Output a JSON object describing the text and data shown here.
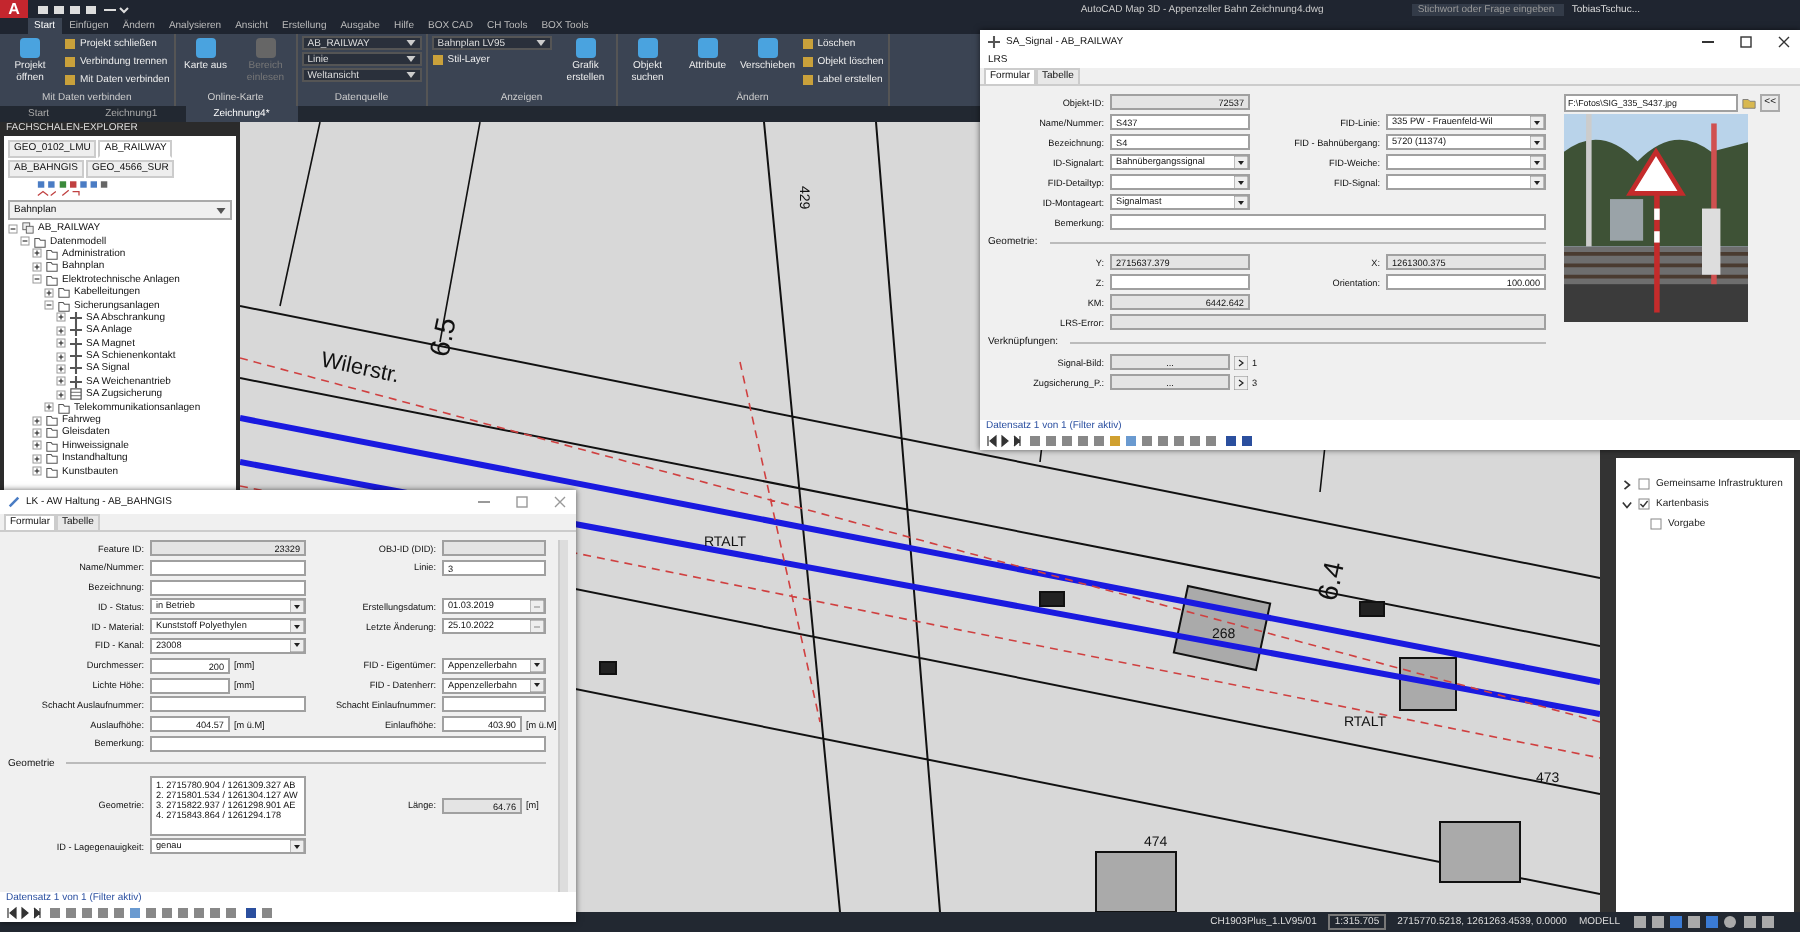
{
  "title_bar": {
    "app_logo": "A",
    "title": "AutoCAD Map 3D - Appenzeller Bahn  Zeichnung4.dwg",
    "search": {
      "placeholder": "Stichwort oder Frage eingeben"
    },
    "user": "TobiasTschuc..."
  },
  "ribbon": {
    "tabs": [
      {
        "label": "Start",
        "selected": true
      },
      {
        "label": "Einfügen",
        "selected": false
      },
      {
        "label": "Ändern",
        "selected": false
      },
      {
        "label": "Analysieren",
        "selected": false
      },
      {
        "label": "Ansicht",
        "selected": false
      },
      {
        "label": "Erstellung",
        "selected": false
      },
      {
        "label": "Ausgabe",
        "selected": false
      },
      {
        "label": "Hilfe",
        "selected": false
      },
      {
        "label": "BOX CAD",
        "selected": false
      },
      {
        "label": "CH Tools",
        "selected": false
      },
      {
        "label": "BOX Tools",
        "selected": false
      }
    ],
    "groups": [
      {
        "title": "Mit Daten verbinden",
        "items": [
          {
            "label": "Projekt öffnen",
            "kind": "large"
          },
          {
            "label": "Projekt schließen",
            "kind": "small"
          },
          {
            "label": "Verbindung trennen",
            "kind": "small"
          },
          {
            "label": "Mit Daten verbinden",
            "kind": "small"
          }
        ]
      },
      {
        "title": "Online-Karte",
        "items": [
          {
            "label": "Karte aus",
            "kind": "large"
          },
          {
            "label": "Bereich einlesen",
            "kind": "large",
            "disabled": true
          }
        ]
      },
      {
        "title": "Datenquelle",
        "items": [
          {
            "label": "AB_RAILWAY",
            "kind": "dropdown"
          },
          {
            "label": "Linie",
            "kind": "dropdown"
          },
          {
            "label": "Weltansicht",
            "kind": "dropdown"
          }
        ]
      },
      {
        "title": "Anzeigen",
        "items": [
          {
            "label": "Bahnplan LV95",
            "kind": "dropdown"
          },
          {
            "label": "Stil-Layer",
            "kind": "small"
          },
          {
            "label": "Grafik erstellen",
            "kind": "large"
          }
        ]
      },
      {
        "title": "Ändern",
        "items": [
          {
            "label": "Objekt suchen",
            "kind": "large"
          },
          {
            "label": "Attribute",
            "kind": "large"
          },
          {
            "label": "Verschieben",
            "kind": "large"
          },
          {
            "label": "Löschen",
            "kind": "small"
          },
          {
            "label": "Objekt löschen",
            "kind": "small"
          },
          {
            "label": "Label erstellen",
            "kind": "small"
          }
        ]
      }
    ]
  },
  "document_tabs": [
    {
      "label": "Start",
      "selected": false
    },
    {
      "label": "Zeichnung1",
      "selected": false
    },
    {
      "label": "Zeichnung4*",
      "selected": true
    }
  ],
  "explorer": {
    "title": "FACHSCHALEN-EXPLORER",
    "tabs": [
      {
        "label": "GEO_0102_LMU",
        "selected": false
      },
      {
        "label": "AB_RAILWAY",
        "selected": true
      },
      {
        "label": "AB_BAHNGIS",
        "selected": false
      },
      {
        "label": "GEO_4566_SUR",
        "selected": false
      }
    ],
    "view": "Bahnplan",
    "tree": [
      {
        "label": "AB_RAILWAY",
        "kind": "root",
        "expanded": true,
        "children": [
          {
            "label": "Datenmodell",
            "kind": "model",
            "expanded": true,
            "children": [
              {
                "label": "Administration",
                "kind": "folder",
                "expanded": false
              },
              {
                "label": "Bahnplan",
                "kind": "folder",
                "expanded": false
              },
              {
                "label": "Elektrotechnische Anlagen",
                "kind": "folder",
                "expanded": true,
                "children": [
                  {
                    "label": "Kabelleitungen",
                    "kind": "folder",
                    "expanded": false
                  },
                  {
                    "label": "Sicherungsanlagen",
                    "kind": "folder",
                    "expanded": true,
                    "children": [
                      {
                        "label": "SA Abschrankung",
                        "kind": "class",
                        "expanded": false
                      },
                      {
                        "label": "SA Anlage",
                        "kind": "class",
                        "expanded": false
                      },
                      {
                        "label": "SA Magnet",
                        "kind": "class",
                        "expanded": false
                      },
                      {
                        "label": "SA Schienenkontakt",
                        "kind": "class",
                        "expanded": false
                      },
                      {
                        "label": "SA Signal",
                        "kind": "class",
                        "expanded": false
                      },
                      {
                        "label": "SA Weichenantrieb",
                        "kind": "class",
                        "expanded": false
                      },
                      {
                        "label": "SA Zugsicherung",
                        "kind": "table",
                        "expanded": false
                      }
                    ]
                  },
                  {
                    "label": "Telekommunikationsanlagen",
                    "kind": "folder",
                    "expanded": false
                  }
                ]
              },
              {
                "label": "Fahrweg",
                "kind": "folder",
                "expanded": false
              },
              {
                "label": "Gleisdaten",
                "kind": "folder",
                "expanded": false
              },
              {
                "label": "Hinweissignale",
                "kind": "folder",
                "expanded": false
              },
              {
                "label": "Instandhaltung",
                "kind": "folder",
                "expanded": false
              },
              {
                "label": "Kunstbauten",
                "kind": "folder",
                "expanded": false
              }
            ]
          }
        ]
      }
    ]
  },
  "map": {
    "labels": [
      "Wilerstr.",
      "6.5",
      "429",
      "6.4",
      "RTALT",
      "RTALT",
      "474",
      "473",
      "268"
    ]
  },
  "layer_palette": {
    "items": [
      {
        "label": "Gemeinsame Infrastrukturen",
        "checked": false,
        "expanded": false
      },
      {
        "label": "Kartenbasis",
        "checked": true,
        "expanded": true,
        "children": [
          {
            "label": "Vorgabe",
            "checked": false
          }
        ]
      }
    ]
  },
  "signal_window": {
    "title": "SA_Signal - AB_RAILWAY",
    "menu": "LRS",
    "tabs": [
      {
        "label": "Formular",
        "selected": true
      },
      {
        "label": "Tabelle",
        "selected": false
      }
    ],
    "rows": [
      {
        "left": {
          "label": "Objekt-ID:",
          "kind": "readonly-number",
          "value": "72537"
        }
      },
      {
        "left": {
          "label": "Name/Nummer:",
          "kind": "text",
          "value": "S437"
        },
        "right": {
          "label": "FID-Linie:",
          "kind": "dropdown",
          "value": "335 PW - Frauenfeld-Wil"
        }
      },
      {
        "left": {
          "label": "Bezeichnung:",
          "kind": "text",
          "value": "S4"
        },
        "right": {
          "label": "FID - Bahnübergang:",
          "kind": "dropdown",
          "value": "5720 (11374)"
        }
      },
      {
        "left": {
          "label": "ID-Signalart:",
          "kind": "dropdown",
          "value": "Bahnübergangssignal"
        },
        "right": {
          "label": "FID-Weiche:",
          "kind": "dropdown"
        }
      },
      {
        "left": {
          "label": "FID-Detailtyp:",
          "kind": "dropdown"
        },
        "right": {
          "label": "FID-Signal:",
          "kind": "dropdown"
        }
      },
      {
        "left": {
          "label": "ID-Montageart:",
          "kind": "dropdown",
          "value": "Signalmast"
        }
      },
      {
        "wide": {
          "label": "Bemerkung:",
          "kind": "text"
        }
      },
      {
        "section": "Geometrie:"
      },
      {
        "left": {
          "label": "Y:",
          "kind": "readonly",
          "value": "2715637.379"
        },
        "right": {
          "label": "X:",
          "kind": "readonly",
          "value": "1261300.375"
        }
      },
      {
        "left": {
          "label": "Z:",
          "kind": "text"
        },
        "right": {
          "label": "Orientation:",
          "kind": "number",
          "value": "100.000"
        }
      },
      {
        "left": {
          "label": "KM:",
          "kind": "readonly-number",
          "value": "6442.642"
        }
      },
      {
        "wide": {
          "label": "LRS-Error:",
          "kind": "readonly"
        }
      },
      {
        "section": "Verknüpfungen:"
      },
      {
        "left": {
          "label": "Signal-Bild:",
          "kind": "link",
          "value": "...",
          "count": "1"
        }
      },
      {
        "left": {
          "label": "Zugsicherung_P.:",
          "kind": "link",
          "value": "...",
          "count": "3"
        }
      }
    ],
    "photo": {
      "path": "F:\\Fotos\\SIG_335_S437.jpg",
      "button": "<<",
      "kind": "picture"
    },
    "footer": "Datensatz 1 von 1 (Filter aktiv)"
  },
  "haltung_window": {
    "title": "LK - AW Haltung - AB_BAHNGIS",
    "tabs": [
      {
        "label": "Formular",
        "selected": true
      },
      {
        "label": "Tabelle",
        "selected": false
      }
    ],
    "rows": [
      {
        "left": {
          "label": "Feature ID:",
          "kind": "readonly-number",
          "value": "23329"
        },
        "right": {
          "label": "OBJ-ID (DID):",
          "kind": "readonly"
        }
      },
      {
        "left": {
          "label": "Name/Nummer:",
          "kind": "text"
        },
        "right": {
          "label": "Linie:",
          "kind": "text",
          "value": "3"
        }
      },
      {
        "left": {
          "label": "Bezeichnung:",
          "kind": "text"
        }
      },
      {
        "left": {
          "label": "ID - Status:",
          "kind": "dropdown",
          "value": "in Betrieb"
        },
        "right": {
          "label": "Erstellungsdatum:",
          "kind": "date",
          "value": "01.03.2019"
        }
      },
      {
        "left": {
          "label": "ID - Material:",
          "kind": "dropdown",
          "value": "Kunststoff Polyethylen"
        },
        "right": {
          "label": "Letzte Änderung:",
          "kind": "date",
          "value": "25.10.2022"
        }
      },
      {
        "left": {
          "label": "FID - Kanal:",
          "kind": "dropdown",
          "value": "23008"
        }
      },
      {
        "left": {
          "label": "Durchmesser:",
          "kind": "number",
          "value": "200",
          "unit": "[mm]"
        },
        "right": {
          "label": "FID - Eigentümer:",
          "kind": "dropdown",
          "value": "Appenzellerbahn"
        }
      },
      {
        "left": {
          "label": "Lichte Höhe:",
          "kind": "number",
          "unit": "[mm]"
        },
        "right": {
          "label": "FID - Datenherr:",
          "kind": "dropdown",
          "value": "Appenzellerbahn"
        }
      },
      {
        "left": {
          "label": "Schacht Auslaufnummer:",
          "kind": "number"
        },
        "right": {
          "label": "Schacht Einlaufnummer:",
          "kind": "number"
        }
      },
      {
        "left": {
          "label": "Auslaufhöhe:",
          "kind": "number",
          "value": "404.57",
          "unit": "[m ü.M]"
        },
        "right": {
          "label": "Einlaufhöhe:",
          "kind": "number",
          "value": "403.90",
          "unit": "[m ü.M]"
        }
      },
      {
        "wide": {
          "label": "Bemerkung:",
          "kind": "text"
        }
      },
      {
        "section": "Geometrie"
      },
      {
        "left": {
          "label": "Geometrie:",
          "kind": "list",
          "lines": [
            "1. 2715780.904 / 1261309.327 AB",
            "2. 2715801.534 / 1261304.127 AW",
            "3. 2715822.937 / 1261298.901 AE",
            "4. 2715843.864 / 1261294.178"
          ]
        },
        "right": {
          "label": "Länge:",
          "kind": "readonly-number",
          "value": "64.76",
          "unit": "[m]"
        }
      },
      {
        "left": {
          "label": "ID - Lagegenauigkeit:",
          "kind": "dropdown",
          "value": "genau"
        }
      }
    ],
    "footer": "Datensatz 1 von 1 (Filter aktiv)"
  },
  "status_bar": {
    "items": [
      "CH1903Plus_1.LV95/01",
      "1:315.705",
      "2715770.5218, 1261263.4539, 0.0000",
      "MODELL"
    ]
  }
}
